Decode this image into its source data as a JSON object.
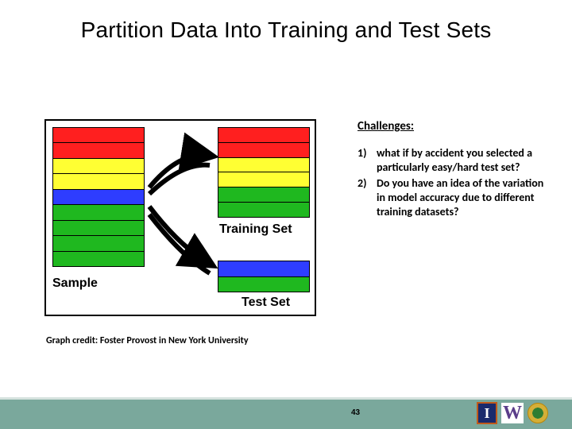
{
  "title": "Partition Data Into Training and Test Sets",
  "diagram": {
    "sample_label": "Sample",
    "training_label": "Training Set",
    "test_label": "Test Set",
    "sample_colors": [
      "red",
      "red",
      "yellow",
      "yellow",
      "blue",
      "green",
      "green",
      "green",
      "green"
    ],
    "training_colors": [
      "red",
      "red",
      "yellow",
      "yellow",
      "green",
      "green"
    ],
    "test_colors": [
      "blue",
      "green"
    ]
  },
  "challenges": {
    "heading": "Challenges:",
    "items": [
      {
        "n": "1)",
        "text": "what if by accident you selected a particularly easy/hard test set?"
      },
      {
        "n": "2)",
        "text": "Do you have an idea of the variation in model accuracy due to different training datasets?"
      }
    ]
  },
  "credit": "Graph credit: Foster Provost in New York University",
  "footer": {
    "page": "43",
    "logo_i": "I",
    "logo_w": "W"
  }
}
